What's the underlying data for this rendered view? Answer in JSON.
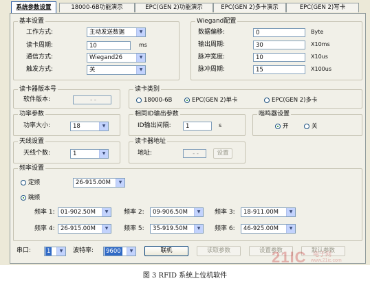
{
  "tabs": [
    {
      "label": "系统参数设置",
      "active": true
    },
    {
      "label": "18000-6B功能演示",
      "active": false
    },
    {
      "label": "EPC(GEN 2)功能演示",
      "active": false
    },
    {
      "label": "EPC(GEN 2)多卡演示",
      "active": false
    },
    {
      "label": "EPC(GEN 2)写卡",
      "active": false
    }
  ],
  "basic": {
    "title": "基本设置",
    "work_mode_label": "工作方式:",
    "work_mode_value": "主动发送数据",
    "read_period_label": "读卡周期:",
    "read_period_value": "10",
    "read_period_unit": "ms",
    "comm_label": "通信方式:",
    "comm_value": "Wiegand26",
    "trigger_label": "触发方式:",
    "trigger_value": "关"
  },
  "wiegand": {
    "title": "Wiegand配置",
    "offset_label": "数据偏移:",
    "offset_value": "0",
    "offset_unit": "Byte",
    "out_period_label": "输出周期:",
    "out_period_value": "30",
    "out_period_unit": "X10ms",
    "pulse_width_label": "脉冲宽度:",
    "pulse_width_value": "10",
    "pulse_width_unit": "X10us",
    "pulse_period_label": "脉冲周期:",
    "pulse_period_value": "15",
    "pulse_period_unit": "X100us"
  },
  "version": {
    "title": "读卡器版本号",
    "sw_label": "软件版本:",
    "sw_value": "- -"
  },
  "card_type": {
    "title": "读卡类别",
    "options": [
      {
        "label": "18000-6B",
        "selected": false
      },
      {
        "label": "EPC(GEN 2)单卡",
        "selected": true
      },
      {
        "label": "EPC(GEN 2)多卡",
        "selected": false
      }
    ]
  },
  "power": {
    "title": "功率参数",
    "label": "功率大小:",
    "value": "18"
  },
  "same_id": {
    "title": "相同ID输出参数",
    "label": "ID输出间隔:",
    "value": "1",
    "unit": "s"
  },
  "buzzer": {
    "title": "嗡鸣器设置",
    "options": [
      {
        "label": "开",
        "selected": true
      },
      {
        "label": "关",
        "selected": false
      }
    ]
  },
  "antenna": {
    "title": "天线设置",
    "label": "天线个数:",
    "value": "1"
  },
  "reader_addr": {
    "title": "读卡器地址",
    "label": "地址:",
    "value": "- -",
    "button": "设置"
  },
  "freq": {
    "title": "频率设置",
    "fixed_label": "定频",
    "fixed_selected": false,
    "fixed_value": "26-915.00M",
    "hop_label": "跳频",
    "hop_selected": true,
    "channels": [
      {
        "label": "频率 1:",
        "value": "01-902.50M"
      },
      {
        "label": "频率 2:",
        "value": "09-906.50M"
      },
      {
        "label": "频率 3:",
        "value": "18-911.00M"
      },
      {
        "label": "频率 4:",
        "value": "26-915.00M"
      },
      {
        "label": "频率 5:",
        "value": "35-919.50M"
      },
      {
        "label": "频率 6:",
        "value": "46-925.00M"
      }
    ]
  },
  "bottom": {
    "port_label": "串口:",
    "port_value": "1",
    "baud_label": "波特率:",
    "baud_value": "9600",
    "connect": "联机",
    "read_params": "读取参数",
    "set_params": "设置参数",
    "default_params": "默认参数"
  },
  "caption": "图 3 RFID 系统上位机软件",
  "watermark": "21IC 电子网 www.21ic.com"
}
